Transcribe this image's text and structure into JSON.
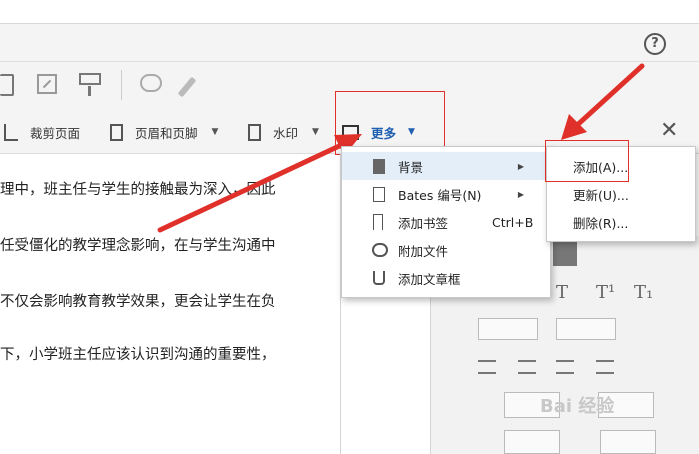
{
  "toolbar": {
    "crop_label": "裁剪页面",
    "header_footer_label": "页眉和页脚",
    "watermark_label": "水印",
    "more_label": "更多",
    "close_glyph": "✕",
    "help_glyph": "?"
  },
  "more_menu": {
    "items": [
      {
        "label": "背景",
        "icon": "page-icon",
        "has_submenu": true
      },
      {
        "label": "Bates 编号(N)",
        "icon": "bates-icon",
        "has_submenu": true
      },
      {
        "label": "添加书签",
        "icon": "bookmark-icon",
        "shortcut": "Ctrl+B"
      },
      {
        "label": "附加文件",
        "icon": "attach-icon"
      },
      {
        "label": "添加文章框",
        "icon": "article-icon"
      }
    ]
  },
  "background_submenu": {
    "items": [
      {
        "label": "添加(A)..."
      },
      {
        "label": "更新(U)..."
      },
      {
        "label": "删除(R)..."
      }
    ]
  },
  "document": {
    "lines": [
      "理中，班主任与学生的接触最为深入，因此",
      "任受僵化的教学理念影响，在与学生沟通中",
      "不仅会影响教育教学效果，更会让学生在负",
      "下，小学班主任应该认识到沟通的重要性，"
    ]
  },
  "watermark": {
    "text": "Bai 经验"
  },
  "colors": {
    "accent": "#1f5fb0",
    "annotation_red": "#e0302a",
    "highlight": "#e3eef9"
  }
}
